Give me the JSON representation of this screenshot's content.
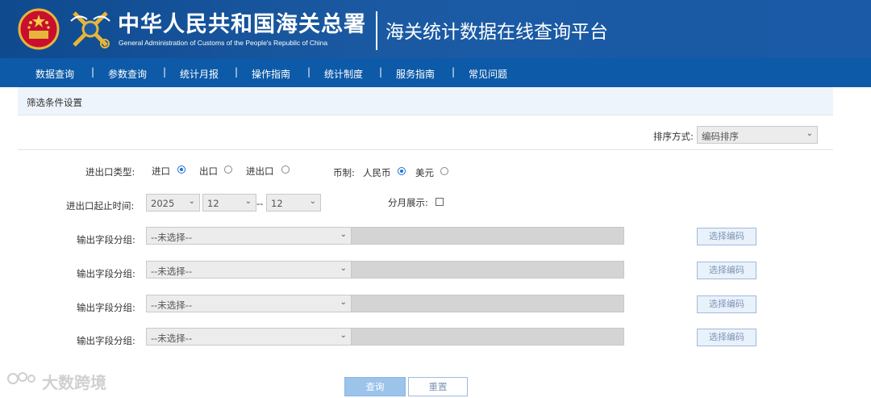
{
  "header": {
    "brand_cn": "中华人民共和国海关总署",
    "brand_en": "General Administration of Customs of the People's Republic of China",
    "platform_title": "海关统计数据在线查询平台"
  },
  "nav": {
    "items": [
      "数据查询",
      "参数查询",
      "统计月报",
      "操作指南",
      "统计制度",
      "服务指南",
      "常见问题"
    ],
    "separator": "|"
  },
  "panel": {
    "title": "筛选条件设置"
  },
  "sort": {
    "label": "排序方式:",
    "value": "编码排序"
  },
  "trade_type": {
    "label": "进出口类型:",
    "options": [
      "进口",
      "出口",
      "进出口"
    ],
    "selected": "进口"
  },
  "currency": {
    "label": "币制:",
    "options": [
      "人民币",
      "美元"
    ],
    "selected": "人民币"
  },
  "period": {
    "label": "进出口起止时间:",
    "year": "2025",
    "month_start": "12",
    "separator": "--",
    "month_end": "12"
  },
  "monthly": {
    "label": "分月展示:",
    "checked": false
  },
  "output_groups": [
    {
      "label": "输出字段分组:",
      "value": "--未选择--",
      "button": "选择编码"
    },
    {
      "label": "输出字段分组:",
      "value": "--未选择--",
      "button": "选择编码"
    },
    {
      "label": "输出字段分组:",
      "value": "--未选择--",
      "button": "选择编码"
    },
    {
      "label": "输出字段分组:",
      "value": "--未选择--",
      "button": "选择编码"
    }
  ],
  "actions": {
    "query": "查询",
    "reset": "重置"
  },
  "watermark": "大数跨境",
  "colors": {
    "header_bg": "#1a5aa6",
    "nav_bg": "#0d5aa8",
    "panel_head_bg": "#eef4fb",
    "accent": "#1a6fd8"
  }
}
